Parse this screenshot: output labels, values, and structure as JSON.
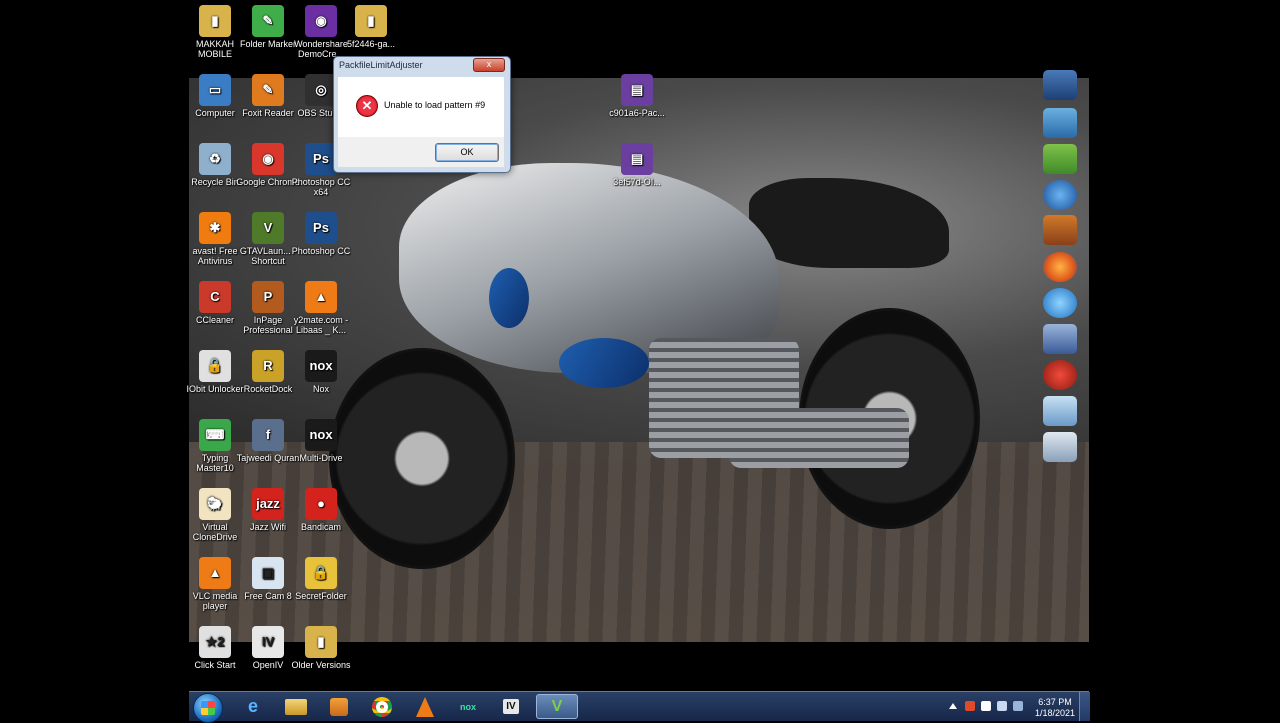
{
  "desktop": {
    "icons": [
      {
        "label": "MAKKAH MOBILE",
        "color": "#d8b24a",
        "glyph": "▮",
        "name": "folder-makkah-icon"
      },
      {
        "label": "Folder Marker",
        "color": "#3fae4a",
        "glyph": "✎",
        "name": "folder-marker-icon"
      },
      {
        "label": "Wondershare DemoCre...",
        "color": "#6b2fa3",
        "glyph": "◉",
        "name": "wondershare-icon"
      },
      {
        "label": "5f2446-ga...",
        "color": "#d8b24a",
        "glyph": "▮",
        "name": "folder-5f2446-icon"
      },
      {
        "label": "Computer",
        "color": "#3a7dc4",
        "glyph": "▭",
        "name": "computer-icon"
      },
      {
        "label": "Foxit Reader",
        "color": "#e07a1f",
        "glyph": "✎",
        "name": "foxit-reader-icon"
      },
      {
        "label": "OBS Studio",
        "color": "#303030",
        "glyph": "◎",
        "name": "obs-studio-icon"
      },
      {
        "label": "Recycle Bin",
        "color": "#8fb0cc",
        "glyph": "♻",
        "name": "recycle-bin-icon"
      },
      {
        "label": "Google Chrome",
        "color": "#d9372b",
        "glyph": "◉",
        "name": "chrome-icon"
      },
      {
        "label": "Photoshop CC x64",
        "color": "#1f4e8c",
        "glyph": "Ps",
        "name": "photoshop-x64-icon"
      },
      {
        "label": "avast! Free Antivirus",
        "color": "#f07c10",
        "glyph": "✱",
        "name": "avast-icon"
      },
      {
        "label": "GTAVLaun... - Shortcut",
        "color": "#4f7a2a",
        "glyph": "V",
        "name": "gtav-launcher-icon"
      },
      {
        "label": "Photoshop CC",
        "color": "#1f4e8c",
        "glyph": "Ps",
        "name": "photoshop-icon"
      },
      {
        "label": "CCleaner",
        "color": "#c93a2a",
        "glyph": "C",
        "name": "ccleaner-icon"
      },
      {
        "label": "InPage Professional",
        "color": "#b35a1f",
        "glyph": "P",
        "name": "inpage-icon"
      },
      {
        "label": "y2mate.com - Libaas _ K...",
        "color": "#ef7b16",
        "glyph": "▲",
        "name": "vlc-file-icon"
      },
      {
        "label": "IObit Unlocker",
        "color": "#e0e0e0",
        "glyph": "🔓",
        "name": "iobit-unlocker-icon"
      },
      {
        "label": "RocketDock",
        "color": "#c9a227",
        "glyph": "R",
        "name": "rocketdock-icon"
      },
      {
        "label": "Nox",
        "color": "#1a1a1a",
        "glyph": "nox",
        "name": "nox-icon"
      },
      {
        "label": "Typing Master10",
        "color": "#3aa84a",
        "glyph": "⌨",
        "name": "typing-master-icon"
      },
      {
        "label": "Tajweedi Quran",
        "color": "#5a6f8e",
        "glyph": "f",
        "name": "tajweedi-quran-icon"
      },
      {
        "label": "Multi-Drive",
        "color": "#1a1a1a",
        "glyph": "nox",
        "name": "multi-drive-icon"
      },
      {
        "label": "Virtual CloneDrive",
        "color": "#f2e4c0",
        "glyph": "🐑",
        "name": "virtual-clonedrive-icon"
      },
      {
        "label": "Jazz Wifi",
        "color": "#d4221c",
        "glyph": "jazz",
        "name": "jazz-wifi-icon"
      },
      {
        "label": "Bandicam",
        "color": "#d4221c",
        "glyph": "●",
        "name": "bandicam-icon"
      },
      {
        "label": "VLC media player",
        "color": "#ef7b16",
        "glyph": "▲",
        "name": "vlc-icon"
      },
      {
        "label": "Free Cam 8",
        "color": "#d8e4f0",
        "glyph": "▣",
        "name": "free-cam-icon"
      },
      {
        "label": "SecretFolder",
        "color": "#e8c23a",
        "glyph": "🔒",
        "name": "secret-folder-icon"
      },
      {
        "label": "Click Start",
        "color": "#e0e0e0",
        "glyph": "★2",
        "name": "click-start-icon"
      },
      {
        "label": "OpenIV",
        "color": "#e8e8e8",
        "glyph": "IV",
        "name": "openiv-icon"
      },
      {
        "label": "Older Versions",
        "color": "#d8b24a",
        "glyph": "▮",
        "name": "older-versions-folder-icon"
      },
      {
        "label": "c901a6-Pac...",
        "color": "#6a3fa0",
        "glyph": "▤",
        "name": "winrar-c901a6-icon"
      },
      {
        "label": "3ef57d-OI...",
        "color": "#6a3fa0",
        "glyph": "▤",
        "name": "winrar-3ef57d-icon"
      }
    ]
  },
  "dialog": {
    "title": "PackfileLimitAdjuster",
    "close_label": "x",
    "error_glyph": "✕",
    "message": "Unable to load pattern #9",
    "ok_label": "OK"
  },
  "taskbar": {
    "ie_glyph": "e",
    "nox_glyph": "nox",
    "openiv_glyph": "IV",
    "gta_glyph": "V",
    "time": "6:37 PM",
    "date": "1/18/2021"
  }
}
